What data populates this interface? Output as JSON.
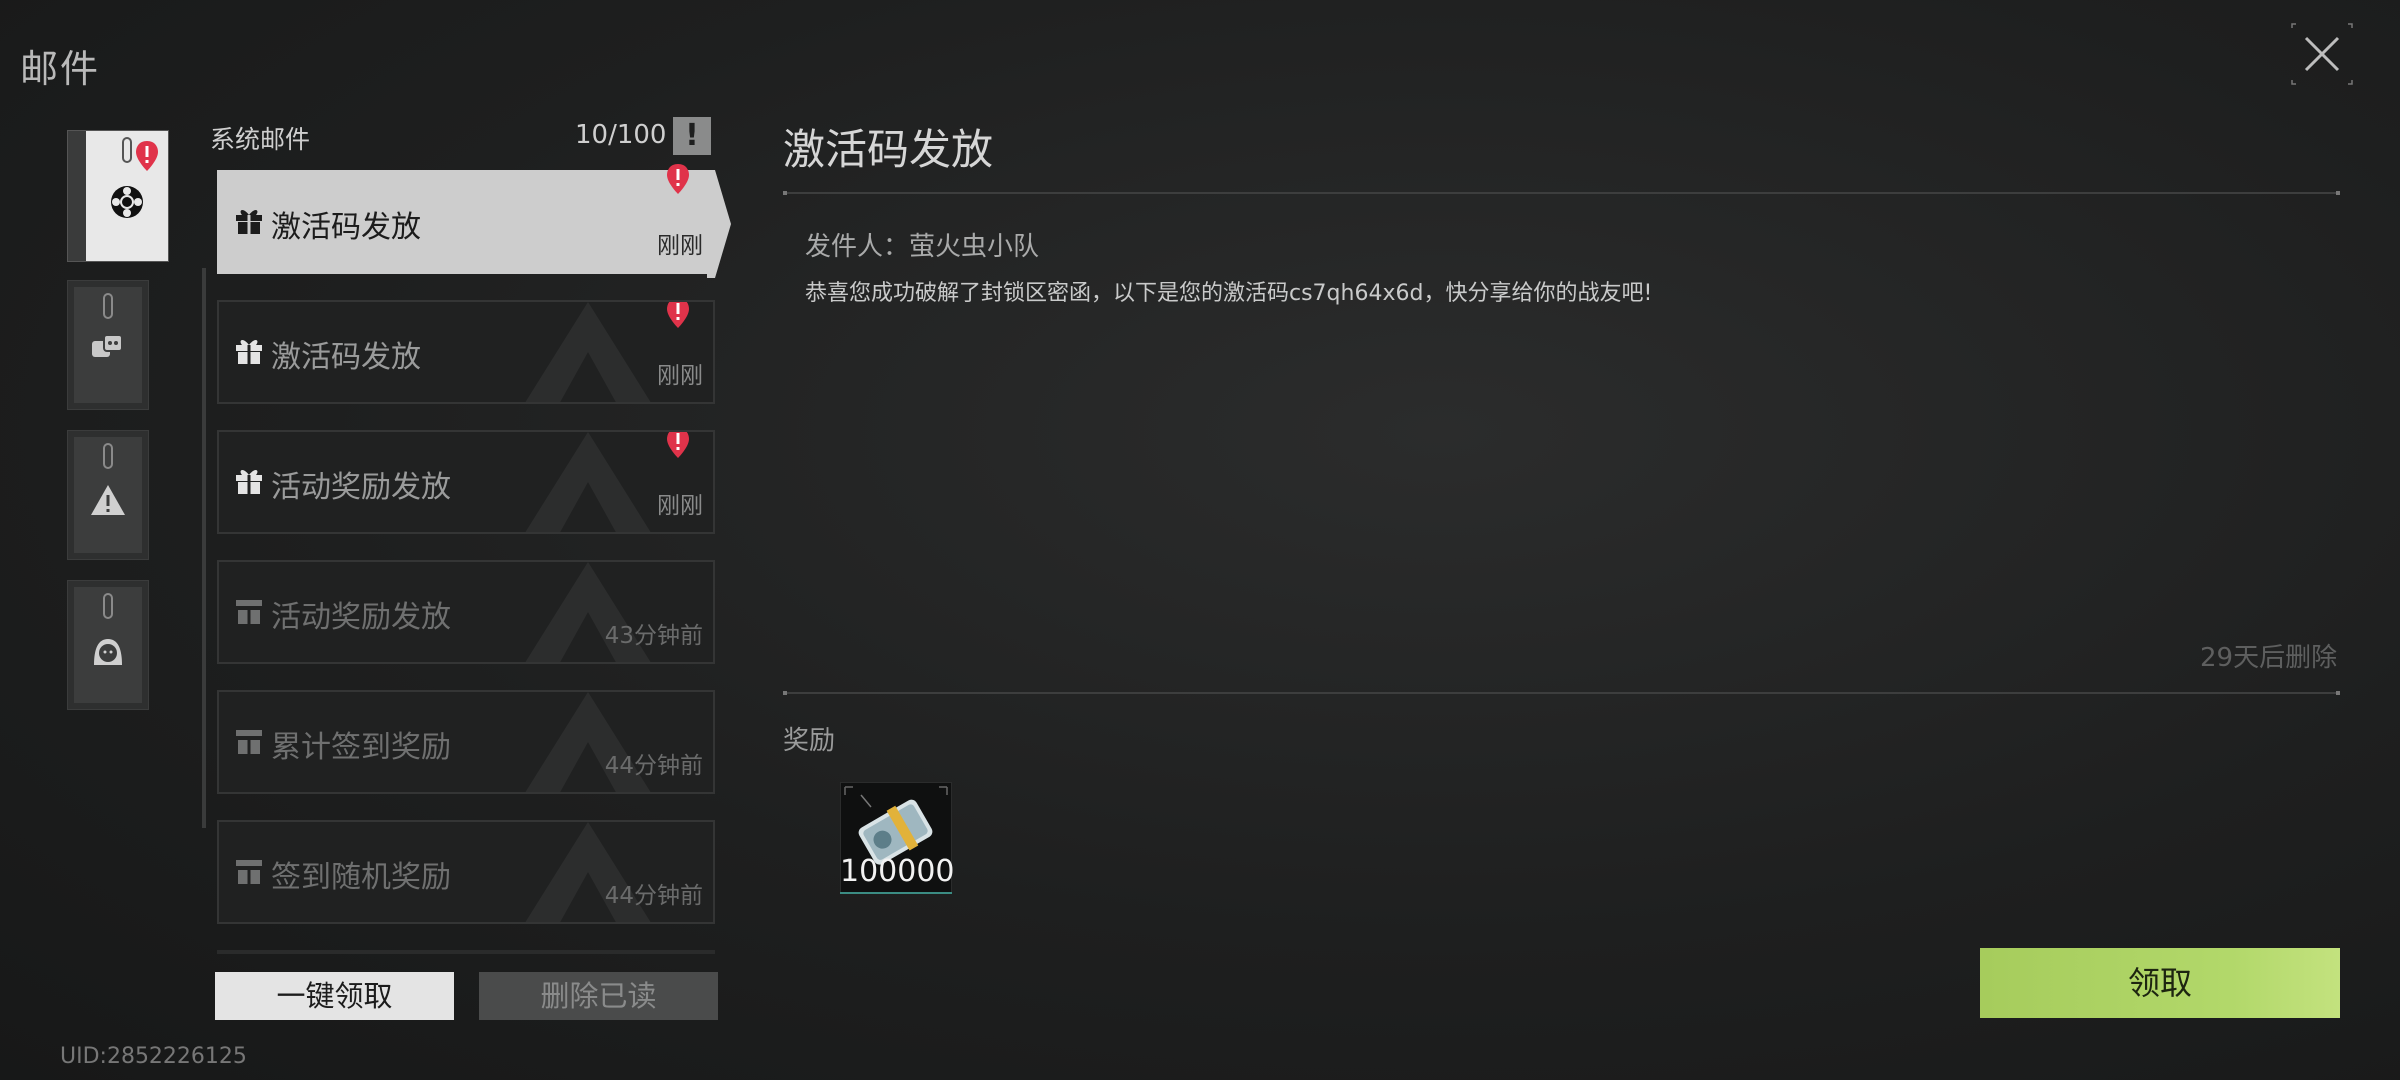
{
  "header": {
    "title": "邮件",
    "close_icon": "close-icon"
  },
  "categories": [
    {
      "name": "system",
      "icon": "gear-icon",
      "active": true,
      "unread": true
    },
    {
      "name": "chat",
      "icon": "chat-bubbles-icon",
      "active": false,
      "unread": false
    },
    {
      "name": "warning",
      "icon": "warning-icon",
      "active": false,
      "unread": false
    },
    {
      "name": "friend",
      "icon": "avatar-icon",
      "active": false,
      "unread": false
    }
  ],
  "list": {
    "title": "系统邮件",
    "count": "10/100",
    "info_glyph": "!",
    "items": [
      {
        "subject": "激活码发放",
        "time": "刚刚",
        "unread": true,
        "selected": true
      },
      {
        "subject": "激活码发放",
        "time": "刚刚",
        "unread": true,
        "selected": false
      },
      {
        "subject": "活动奖励发放",
        "time": "刚刚",
        "unread": true,
        "selected": false
      },
      {
        "subject": "活动奖励发放",
        "time": "43分钟前",
        "unread": false,
        "selected": false
      },
      {
        "subject": "累计签到奖励",
        "time": "44分钟前",
        "unread": false,
        "selected": false
      },
      {
        "subject": "签到随机奖励",
        "time": "44分钟前",
        "unread": false,
        "selected": false
      }
    ],
    "claim_all_label": "一键领取",
    "delete_read_label": "删除已读"
  },
  "uid": "UID:2852226125",
  "detail": {
    "title": "激活码发放",
    "sender": "发件人：萤火虫小队",
    "body": "恭喜您成功破解了封锁区密函，以下是您的激活码cs7qh64x6d，快分享给你的战友吧!",
    "expire": "29天后删除",
    "reward_label": "奖励",
    "rewards": [
      {
        "icon": "cash-bundle-icon",
        "amount": "100000"
      }
    ],
    "claim_label": "领取"
  },
  "colors": {
    "accent_green": "#b2d86a",
    "unread_red": "#e0334a",
    "selected_item": "#cdcdcd"
  }
}
